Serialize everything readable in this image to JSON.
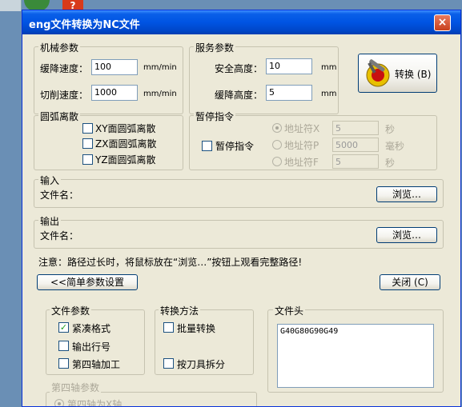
{
  "window": {
    "title": "eng文件转换为NC文件",
    "close_icon": "×"
  },
  "mechanical": {
    "legend": "机械参数",
    "slow_down_label": "缓降速度：",
    "slow_down_value": "100",
    "slow_down_unit": "mm/min",
    "cut_speed_label": "切削速度：",
    "cut_speed_value": "1000",
    "cut_speed_unit": "mm/min"
  },
  "service": {
    "legend": "服务参数",
    "safe_height_label": "安全高度：",
    "safe_height_value": "10",
    "safe_height_unit": "mm",
    "slow_height_label": "缓降高度：",
    "slow_height_value": "5",
    "slow_height_unit": "mm"
  },
  "convert_button": {
    "label": "转换 (B)"
  },
  "arc": {
    "legend": "圆弧离散",
    "xy": "XY面圆弧离散",
    "zx": "ZX面圆弧离散",
    "yz": "YZ面圆弧离散"
  },
  "pause": {
    "legend": "暂停指令",
    "checkbox_label": "暂停指令",
    "addr_x_label": "地址符X",
    "addr_x_value": "5",
    "addr_x_unit": "秒",
    "addr_p_label": "地址符P",
    "addr_p_value": "5000",
    "addr_p_unit": "毫秒",
    "addr_f_label": "地址符F",
    "addr_f_value": "5",
    "addr_f_unit": "秒"
  },
  "input_section": {
    "legend": "输入",
    "filename_label": "文件名：",
    "browse": "浏览…"
  },
  "output_section": {
    "legend": "输出",
    "filename_label": "文件名：",
    "browse": "浏览…"
  },
  "note": "注意：路径过长时，将鼠标放在“浏览…”按钮上观看完整路径!",
  "simple_settings_button": "<<简单参数设置",
  "close_button": "关闭 (C)",
  "file_params": {
    "legend": "文件参数",
    "compact": "紧凑格式",
    "output_line": "输出行号",
    "fourth_axis": "第四轴加工"
  },
  "convert_method": {
    "legend": "转换方法",
    "batch": "批量转换",
    "split_by_tool": "按刀具拆分"
  },
  "file_header": {
    "legend": "文件头",
    "content": "G40G80G90G49"
  },
  "fourth_axis_params": {
    "legend": "第四轴参数",
    "x_axis": "第四轴为X轴"
  },
  "colors": {
    "title_blue": "#0054e3",
    "dialog_bg": "#ece9d8",
    "close_red": "#d8462a",
    "check_green": "#21a121"
  }
}
